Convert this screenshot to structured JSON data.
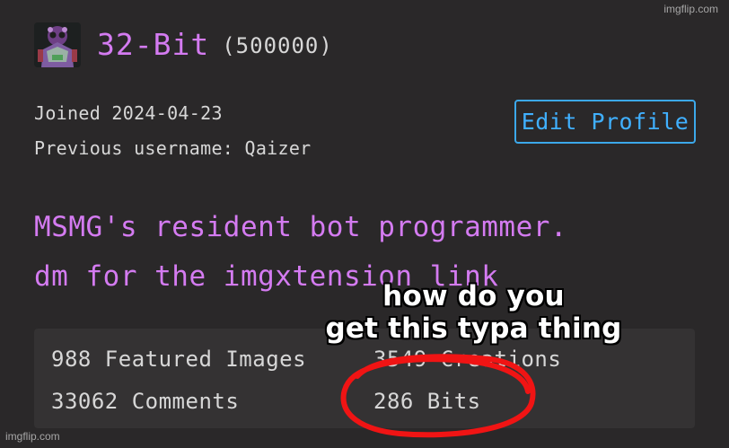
{
  "watermarks": {
    "top": "imgflip.com",
    "bottom": "imgflip.com"
  },
  "profile": {
    "username": "32-Bit",
    "points": "(500000)",
    "joined": "Joined 2024-04-23",
    "previous_username": "Previous username: Qaizer",
    "edit_button": "Edit Profile",
    "bio_lines": [
      "MSMG's resident bot programmer.",
      "dm for the imgxtension link"
    ]
  },
  "stats": {
    "featured_images": "988 Featured Images",
    "creations": "3549 Creations",
    "comments": "33062 Comments",
    "bits": "286 Bits"
  },
  "overlay": {
    "caption_lines": [
      "how do you",
      "get this typa thing"
    ],
    "circle_color": "#f01414"
  },
  "colors": {
    "background": "#2a2829",
    "stats_panel": "#343233",
    "accent_purple": "#d47bf1",
    "accent_blue": "#40b0ff",
    "text": "#d7d7d7"
  },
  "icons": {
    "avatar": "avatar-image"
  }
}
